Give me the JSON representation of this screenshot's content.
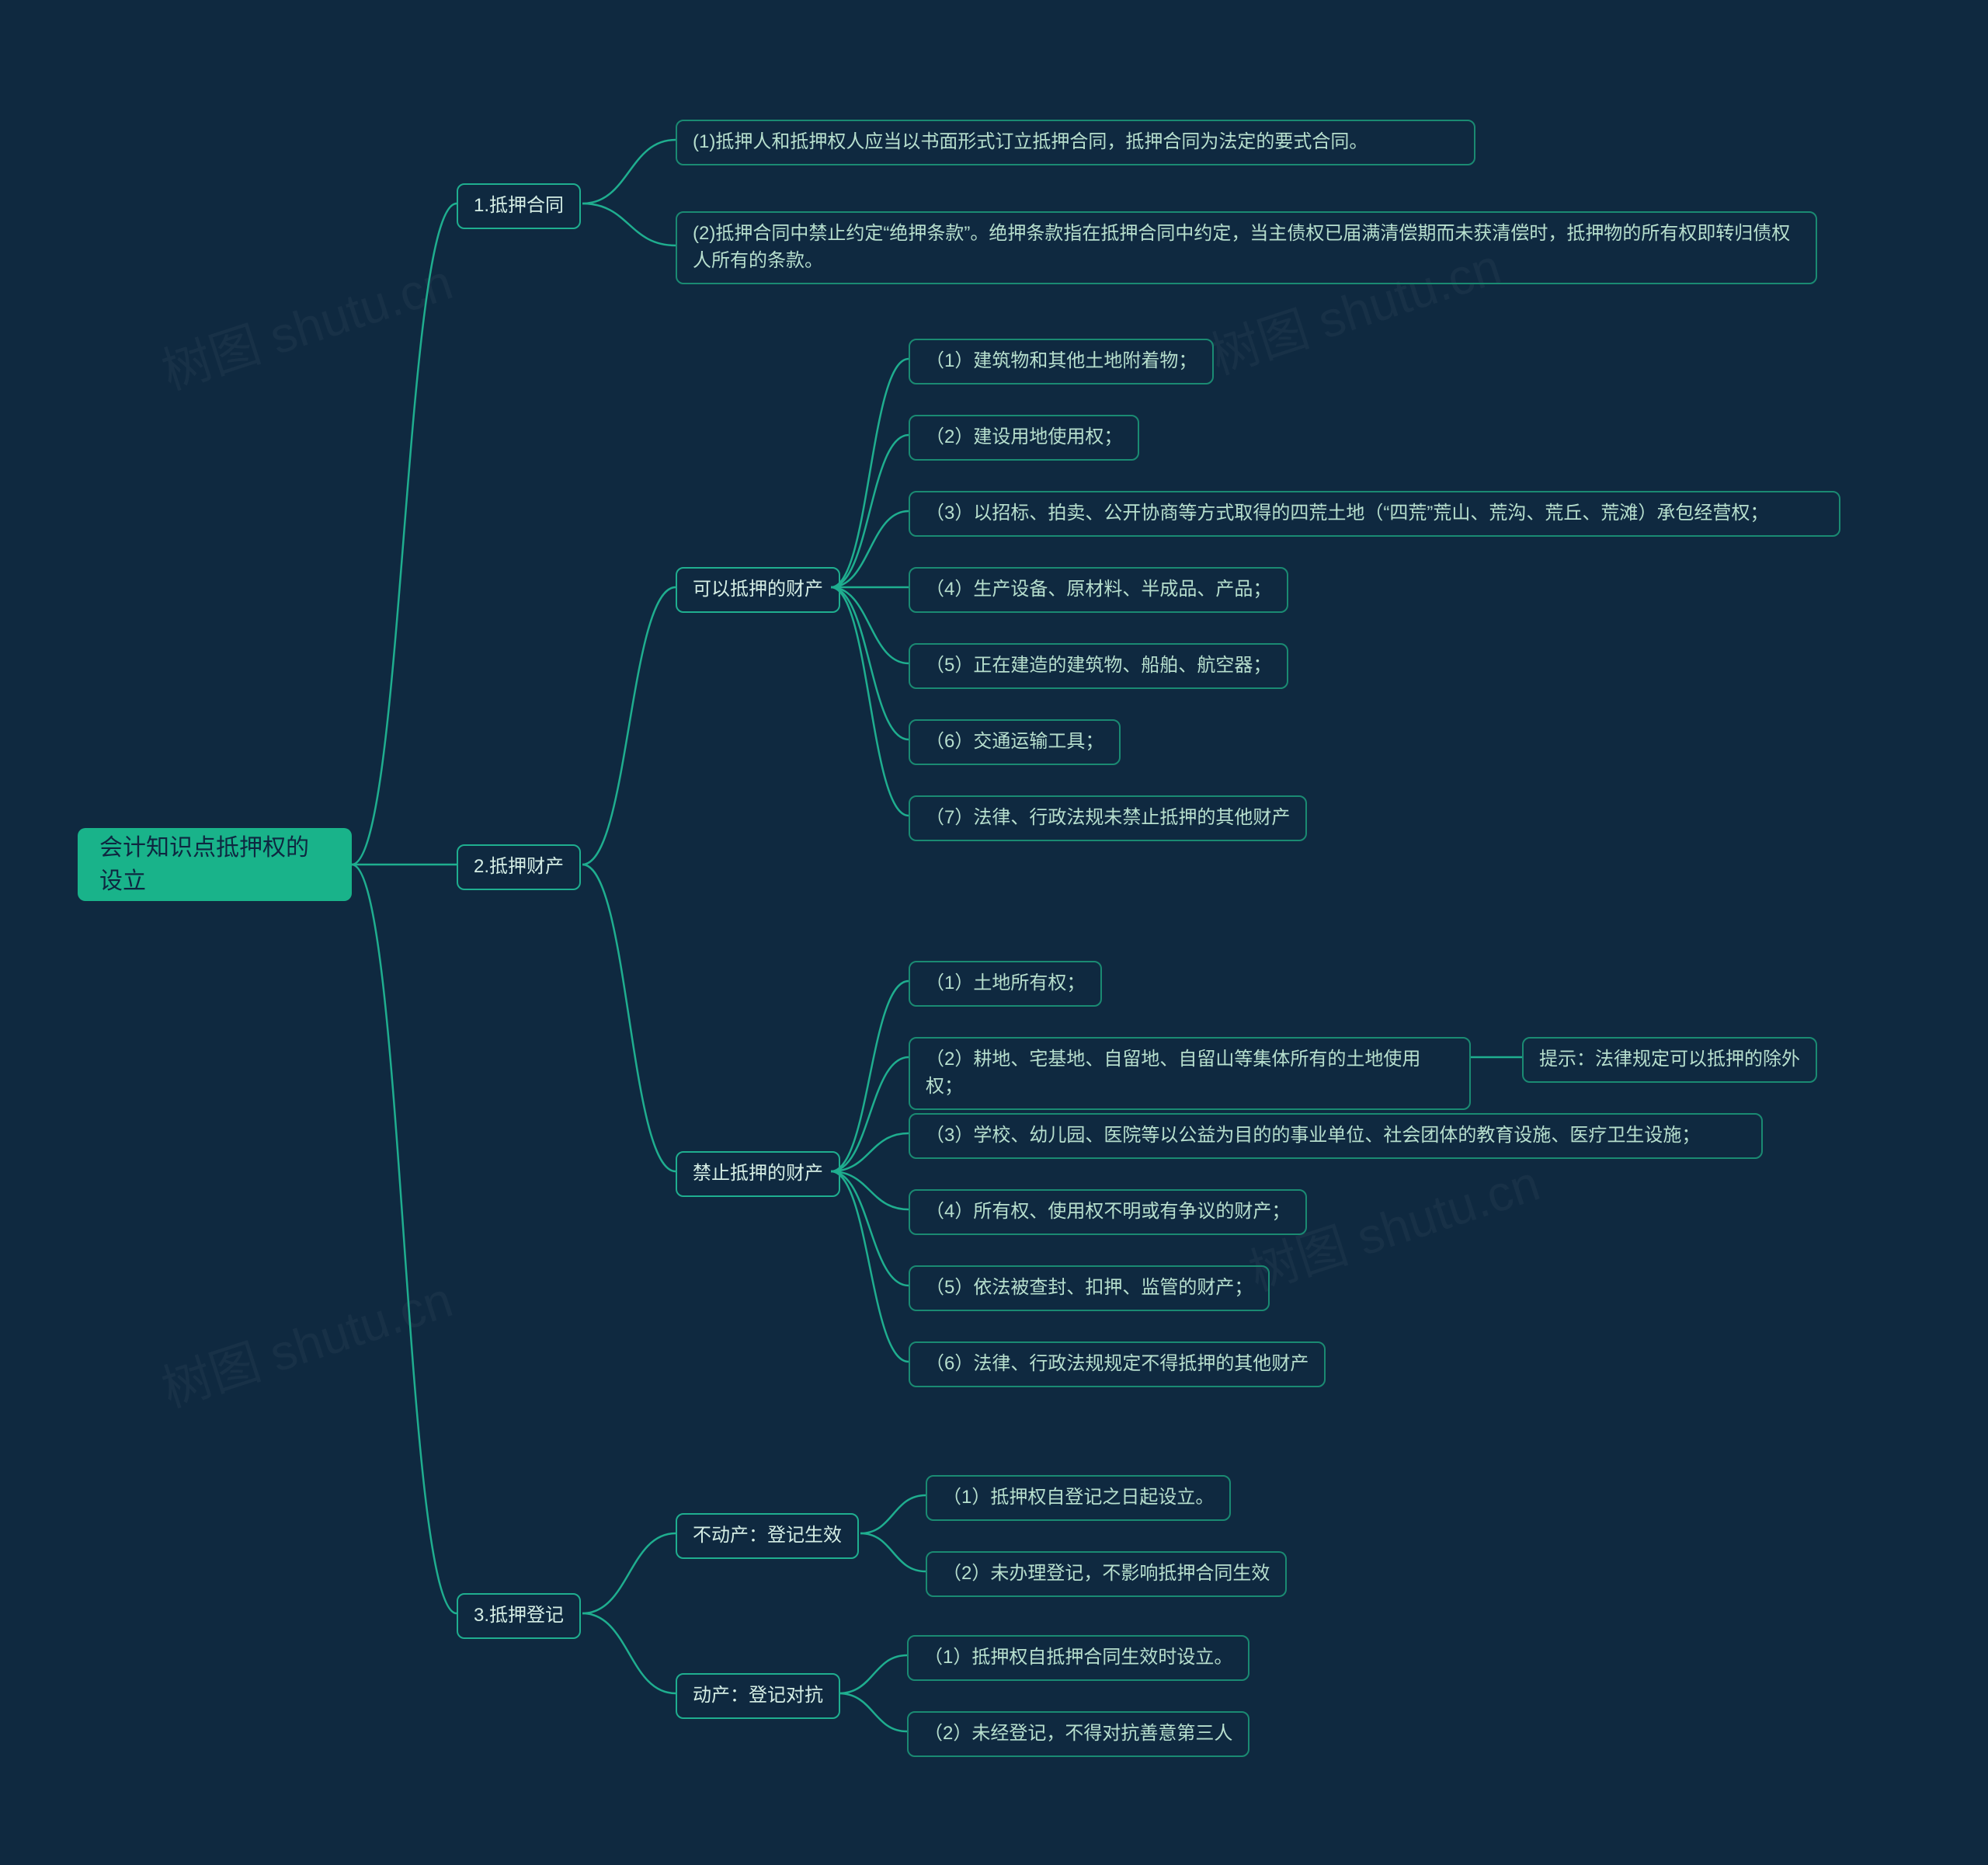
{
  "root": {
    "label": "会计知识点抵押权的设立"
  },
  "n1": {
    "label": "1.抵押合同"
  },
  "n1a": {
    "label": "(1)抵押人和抵押权人应当以书面形式订立抵押合同，抵押合同为法定的要式合同。"
  },
  "n1b": {
    "label": "(2)抵押合同中禁止约定“绝押条款”。绝押条款指在抵押合同中约定，当主债权已届满清偿期而未获清偿时，抵押物的所有权即转归债权人所有的条款。"
  },
  "n2": {
    "label": "2.抵押财产"
  },
  "n2a": {
    "label": "可以抵押的财产"
  },
  "n2a1": {
    "label": "（1）建筑物和其他土地附着物；"
  },
  "n2a2": {
    "label": "（2）建设用地使用权；"
  },
  "n2a3": {
    "label": "（3）以招标、拍卖、公开协商等方式取得的四荒土地（“四荒”荒山、荒沟、荒丘、荒滩）承包经营权；"
  },
  "n2a4": {
    "label": "（4）生产设备、原材料、半成品、产品；"
  },
  "n2a5": {
    "label": "（5）正在建造的建筑物、船舶、航空器；"
  },
  "n2a6": {
    "label": "（6）交通运输工具；"
  },
  "n2a7": {
    "label": "（7）法律、行政法规未禁止抵押的其他财产"
  },
  "n2b": {
    "label": "禁止抵押的财产"
  },
  "n2b1": {
    "label": "（1）土地所有权；"
  },
  "n2b2": {
    "label": "（2）耕地、宅基地、自留地、自留山等集体所有的土地使用权；"
  },
  "n2b2x": {
    "label": "提示：法律规定可以抵押的除外"
  },
  "n2b3": {
    "label": "（3）学校、幼儿园、医院等以公益为目的的事业单位、社会团体的教育设施、医疗卫生设施；"
  },
  "n2b4": {
    "label": "（4）所有权、使用权不明或有争议的财产；"
  },
  "n2b5": {
    "label": "（5）依法被查封、扣押、监管的财产；"
  },
  "n2b6": {
    "label": "（6）法律、行政法规规定不得抵押的其他财产"
  },
  "n3": {
    "label": "3.抵押登记"
  },
  "n3a": {
    "label": "不动产：登记生效"
  },
  "n3a1": {
    "label": "（1）抵押权自登记之日起设立。"
  },
  "n3a2": {
    "label": "（2）未办理登记，不影响抵押合同生效"
  },
  "n3b": {
    "label": "动产：登记对抗"
  },
  "n3b1": {
    "label": "（1）抵押权自抵押合同生效时设立。"
  },
  "n3b2": {
    "label": "（2）未经登记，不得对抗善意第三人"
  },
  "watermark": "树图 shutu.cn"
}
